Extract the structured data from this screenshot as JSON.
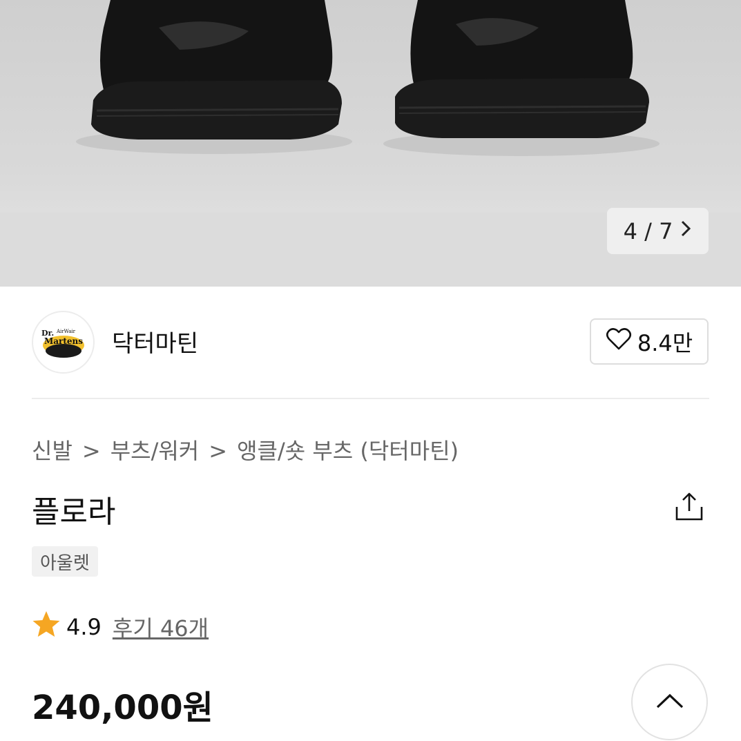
{
  "gallery": {
    "counter_text": "4 / 7",
    "next_icon": "chevron-right-icon"
  },
  "brand": {
    "name": "닥터마틴",
    "logo_text_line1": "Dr.",
    "logo_text_line2": "AirWair",
    "logo_text_line3": "Martens",
    "like_count": "8.4만",
    "like_icon": "heart-outline-icon"
  },
  "breadcrumb": {
    "items": [
      "신발",
      "부츠/워커",
      "앵클/숏 부츠 (닥터마틴)"
    ],
    "separator": ">"
  },
  "product": {
    "name": "플로라",
    "tag": "아울렛",
    "rating": "4.9",
    "reviews": "후기 46개",
    "price": "240,000원",
    "share_icon": "share-icon"
  },
  "colors": {
    "star": "#f5a623",
    "text_primary": "#111111",
    "text_secondary": "#666666"
  }
}
